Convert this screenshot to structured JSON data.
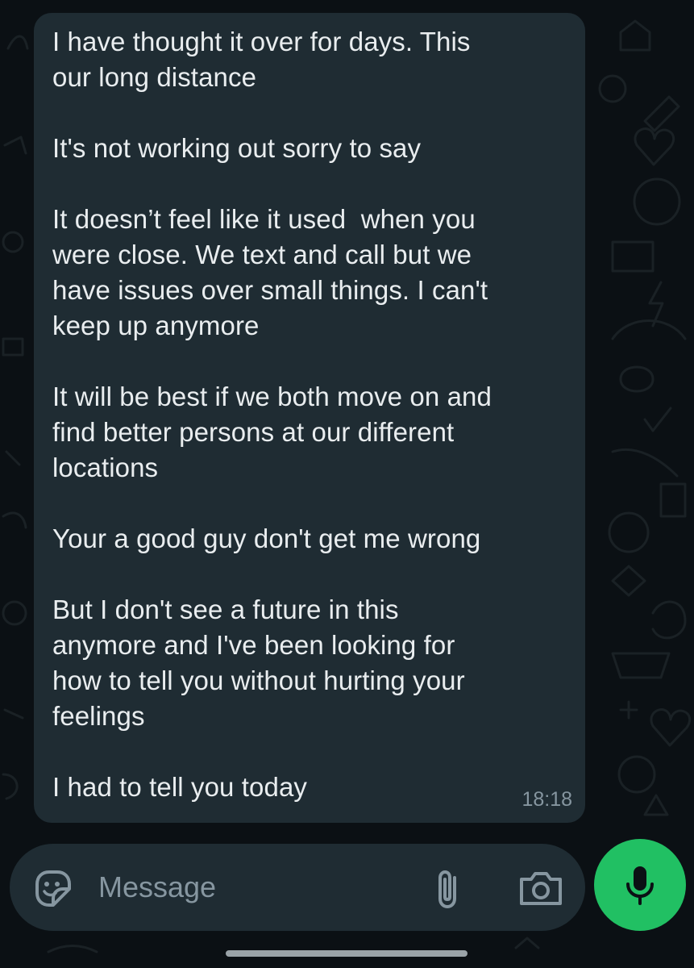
{
  "chat": {
    "message": {
      "paragraphs": [
        "I have thought it over for days. This\nour long distance",
        "It's not working out sorry to say",
        "It doesn’t feel like it used  when you\nwere close. We text and call but we\nhave issues over small things. I can't\nkeep up anymore",
        "It will be best if we both move on and\nfind better persons at our different\nlocations",
        "Your a good guy don't get me wrong",
        "But I don't see a future in this\nanymore and I've been looking for\nhow to tell you without hurting your\nfeelings",
        "I had to tell you today"
      ],
      "time": "18:18"
    }
  },
  "composer": {
    "placeholder": "Message",
    "value": "",
    "icons": {
      "emoji": "sticker-smiley-icon",
      "attach": "paperclip-icon",
      "camera": "camera-icon",
      "mic": "microphone-icon"
    }
  },
  "colors": {
    "background": "#0b1014",
    "bubble": "#1f2c33",
    "text": "#e9edef",
    "muted": "#8696a0",
    "accent": "#21c063"
  }
}
